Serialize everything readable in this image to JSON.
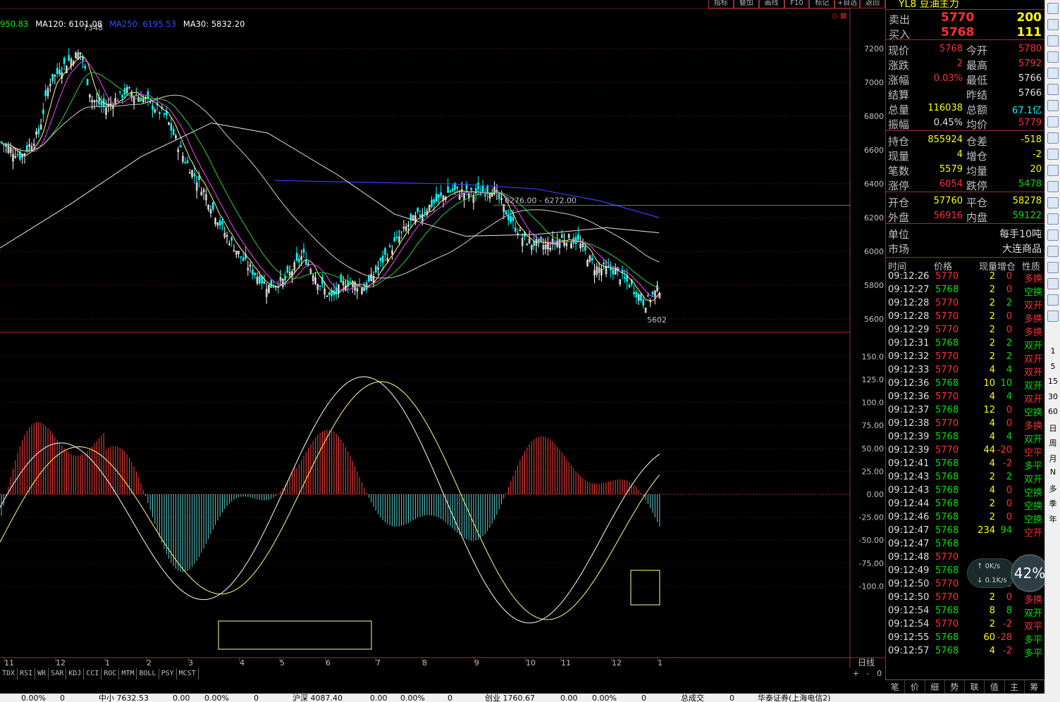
{
  "toolbar": [
    "指标",
    "叠加",
    "画线",
    "F10",
    "标记",
    "+自选",
    "返回"
  ],
  "ma_legend": [
    {
      "label": "950.83",
      "color": "#00ff00"
    },
    {
      "label": "MA120: 6101.08",
      "color": "#ffffff"
    },
    {
      "label": "MA250: 6195.53",
      "color": "#3050ff"
    },
    {
      "label": "MA30: 5832.20",
      "color": "#ffffff"
    }
  ],
  "price_axis": [
    "7200",
    "7000",
    "6800",
    "6600",
    "6400",
    "6200",
    "6000",
    "5800",
    "5600"
  ],
  "macd_axis": [
    "150.0",
    "125.0",
    "100.0",
    "75.00",
    "50.00",
    "25.00",
    "0.00",
    "-25.00",
    "-50.00",
    "-75.00",
    "-100.0"
  ],
  "time_axis": [
    "11",
    "12",
    "1",
    "2",
    "3",
    "4",
    "5",
    "6",
    "7",
    "8",
    "9",
    "10",
    "11",
    "12",
    "1"
  ],
  "period_label": "日线",
  "annotations": {
    "high": "7348",
    "low": "5602",
    "range": "6276.00 - 6272.00"
  },
  "indicator_tabs": [
    "TDX",
    "RSI",
    "WR",
    "SAR",
    "KDJ",
    "CCI",
    "ROC",
    "MTM",
    "BOLL",
    "PSY",
    "MCST"
  ],
  "indicator_ctrl": [
    "+",
    "-",
    "0"
  ],
  "quote": {
    "title": "YL8 豆油主力",
    "sell": {
      "label": "卖出",
      "price": "5770",
      "vol": "200"
    },
    "buy": {
      "label": "买入",
      "price": "5768",
      "vol": "111"
    },
    "rows1": [
      {
        "l1": "现价",
        "v1": "5768",
        "c1": "red",
        "l2": "今开",
        "v2": "5780",
        "c2": "red"
      },
      {
        "l1": "涨跌",
        "v1": "2",
        "c1": "red",
        "l2": "最高",
        "v2": "5792",
        "c2": "red"
      },
      {
        "l1": "涨幅",
        "v1": "0.03%",
        "c1": "red",
        "l2": "最低",
        "v2": "5766",
        "c2": "white"
      },
      {
        "l1": "结算",
        "v1": "",
        "c1": "white",
        "l2": "昨结",
        "v2": "5766",
        "c2": "white"
      },
      {
        "l1": "总量",
        "v1": "116038",
        "c1": "yellow",
        "l2": "总额",
        "v2": "67.1亿",
        "c2": "cyan"
      },
      {
        "l1": "振幅",
        "v1": "0.45%",
        "c1": "white",
        "l2": "均价",
        "v2": "5779",
        "c2": "red"
      }
    ],
    "rows2": [
      {
        "l1": "持仓",
        "v1": "855924",
        "c1": "yellow",
        "l2": "仓差",
        "v2": "-518",
        "c2": "yellow"
      },
      {
        "l1": "现量",
        "v1": "4",
        "c1": "yellow",
        "l2": "增仓",
        "v2": "-2",
        "c2": "yellow"
      },
      {
        "l1": "笔数",
        "v1": "5579",
        "c1": "yellow",
        "l2": "均量",
        "v2": "20",
        "c2": "yellow"
      },
      {
        "l1": "涨停",
        "v1": "6054",
        "c1": "red",
        "l2": "跌停",
        "v2": "5478",
        "c2": "green"
      }
    ],
    "rows3": [
      {
        "l1": "开仓",
        "v1": "57760",
        "c1": "yellow",
        "l2": "平仓",
        "v2": "58278",
        "c2": "yellow"
      },
      {
        "l1": "外盘",
        "v1": "56916",
        "c1": "red",
        "l2": "内盘",
        "v2": "59122",
        "c2": "green"
      }
    ],
    "rows4": [
      {
        "l": "单位",
        "v": "每手10吨"
      },
      {
        "l": "市场",
        "v": "大连商品"
      }
    ],
    "tick_head": [
      "时间",
      "价格",
      "现量",
      "增仓",
      "性质"
    ],
    "ticks": [
      {
        "t": "09:12:26",
        "p": "5770",
        "v": "2",
        "d": "0",
        "k": "多换"
      },
      {
        "t": "09:12:27",
        "p": "5768",
        "v": "2",
        "d": "0",
        "k": "空换"
      },
      {
        "t": "09:12:28",
        "p": "5770",
        "v": "2",
        "d": "2",
        "k": "双开"
      },
      {
        "t": "09:12:28",
        "p": "5770",
        "v": "2",
        "d": "0",
        "k": "多换"
      },
      {
        "t": "09:12:29",
        "p": "5770",
        "v": "2",
        "d": "0",
        "k": "多换"
      },
      {
        "t": "09:12:31",
        "p": "5768",
        "v": "2",
        "d": "2",
        "k": "双开"
      },
      {
        "t": "09:12:32",
        "p": "5770",
        "v": "2",
        "d": "2",
        "k": "双开"
      },
      {
        "t": "09:12:33",
        "p": "5770",
        "v": "4",
        "d": "4",
        "k": "双开"
      },
      {
        "t": "09:12:36",
        "p": "5768",
        "v": "10",
        "d": "10",
        "k": "双开"
      },
      {
        "t": "09:12:36",
        "p": "5770",
        "v": "4",
        "d": "4",
        "k": "双开"
      },
      {
        "t": "09:12:37",
        "p": "5768",
        "v": "12",
        "d": "0",
        "k": "空换"
      },
      {
        "t": "09:12:38",
        "p": "5770",
        "v": "4",
        "d": "0",
        "k": "多换"
      },
      {
        "t": "09:12:39",
        "p": "5768",
        "v": "4",
        "d": "4",
        "k": "双开"
      },
      {
        "t": "09:12:39",
        "p": "5770",
        "v": "44",
        "d": "-20",
        "k": "空平"
      },
      {
        "t": "09:12:41",
        "p": "5768",
        "v": "4",
        "d": "-2",
        "k": "多平"
      },
      {
        "t": "09:12:43",
        "p": "5768",
        "v": "2",
        "d": "2",
        "k": "双开"
      },
      {
        "t": "09:12:43",
        "p": "5768",
        "v": "4",
        "d": "0",
        "k": "空换"
      },
      {
        "t": "09:12:44",
        "p": "5768",
        "v": "2",
        "d": "0",
        "k": "空换"
      },
      {
        "t": "09:12:46",
        "p": "5768",
        "v": "2",
        "d": "0",
        "k": "空换"
      },
      {
        "t": "09:12:47",
        "p": "5768",
        "v": "234",
        "d": "94",
        "k": "空开"
      },
      {
        "t": "09:12:47",
        "p": "5768",
        "v": "",
        "d": "",
        "k": ""
      },
      {
        "t": "09:12:48",
        "p": "5770",
        "v": "",
        "d": "",
        "k": ""
      },
      {
        "t": "09:12:49",
        "p": "5768",
        "v": "4",
        "d": "0",
        "k": ""
      },
      {
        "t": "09:12:50",
        "p": "5770",
        "v": "4",
        "d": "-2",
        "k": "空平"
      },
      {
        "t": "09:12:50",
        "p": "5770",
        "v": "2",
        "d": "0",
        "k": "多换"
      },
      {
        "t": "09:12:54",
        "p": "5768",
        "v": "8",
        "d": "8",
        "k": "双开"
      },
      {
        "t": "09:12:54",
        "p": "5770",
        "v": "2",
        "d": "-2",
        "k": "双平"
      },
      {
        "t": "09:12:55",
        "p": "5768",
        "v": "60",
        "d": "-28",
        "k": "多平"
      },
      {
        "t": "09:12:57",
        "p": "5768",
        "v": "4",
        "d": "-2",
        "k": "多平"
      }
    ],
    "tabs": [
      "笔",
      "价",
      "细",
      "势",
      "联",
      "值",
      "主",
      "筹"
    ]
  },
  "net_badge": {
    "up": "0K/s",
    "down": "0.1K/s",
    "percent": "42%"
  },
  "side_labels": [
    "1",
    "5",
    "15",
    "30",
    "60",
    "日",
    "周",
    "月",
    "N",
    "多",
    "季",
    "年"
  ],
  "side_icon_labels": [
    "RSI",
    "Fs",
    "Fiz",
    "F10"
  ],
  "status_bar": [
    "0.00%",
    "0",
    "中小 7632.53",
    "0.00",
    "0.00%",
    "0",
    "沪深 4087.40",
    "0.00",
    "0.00%",
    "0",
    "创业 1760.67",
    "0.00",
    "0.00%",
    "0",
    "总成交",
    "0",
    "华泰证券(上海电信2)"
  ]
}
